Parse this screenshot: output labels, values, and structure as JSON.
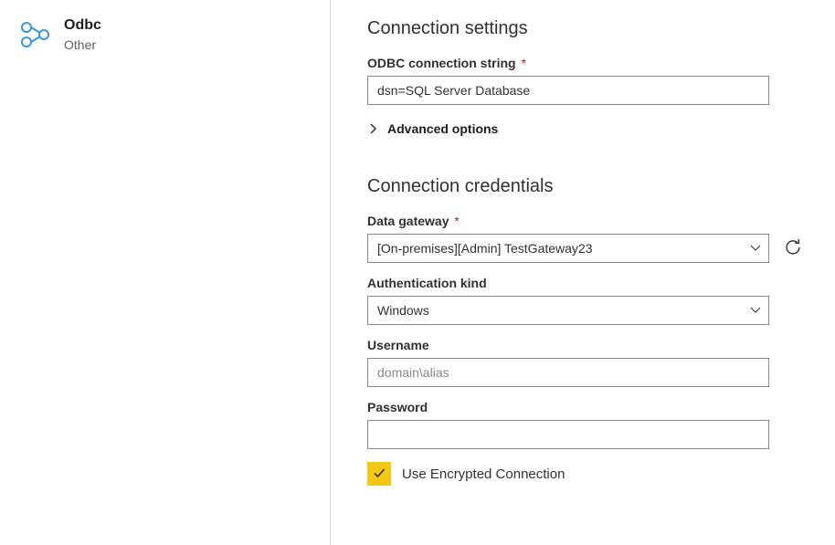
{
  "connector": {
    "title": "Odbc",
    "subtitle": "Other"
  },
  "settings": {
    "heading": "Connection settings",
    "conn_string_label": "ODBC connection string",
    "conn_string_required": "*",
    "conn_string_value": "dsn=SQL Server Database",
    "advanced_label": "Advanced options"
  },
  "credentials": {
    "heading": "Connection credentials",
    "gateway_label": "Data gateway",
    "gateway_required": "*",
    "gateway_value": "[On-premises][Admin] TestGateway23",
    "auth_kind_label": "Authentication kind",
    "auth_kind_value": "Windows",
    "username_label": "Username",
    "username_placeholder": "domain\\alias",
    "username_value": "",
    "password_label": "Password",
    "password_value": "",
    "encrypted_label": "Use Encrypted Connection",
    "encrypted_checked": true
  },
  "colors": {
    "accent": "#f2c811",
    "icon_stroke": "#3a96dd",
    "required": "#a4262c"
  }
}
